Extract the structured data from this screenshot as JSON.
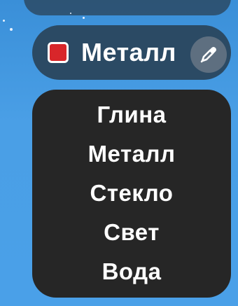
{
  "material_selector": {
    "selected_label": "Металл",
    "selected_color": "#d8262a",
    "picker_icon": "eyedropper-icon"
  },
  "dropdown": {
    "options": [
      {
        "label": "Глина"
      },
      {
        "label": "Металл"
      },
      {
        "label": "Стекло"
      },
      {
        "label": "Свет"
      },
      {
        "label": "Вода"
      }
    ]
  }
}
